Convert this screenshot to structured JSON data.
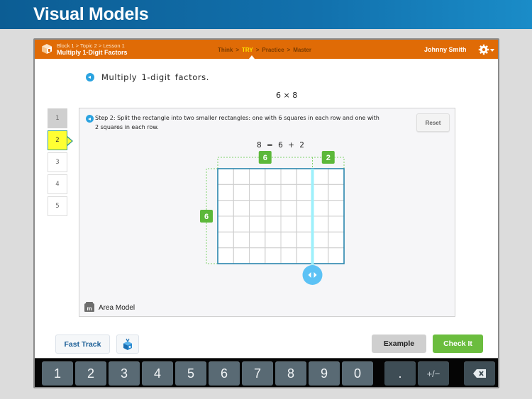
{
  "banner": {
    "title": "Visual Models"
  },
  "header": {
    "breadcrumb": "Block 1 > Topic 2 > Lesson 1",
    "lesson_title": "Multiply 1-Digit Factors",
    "phases": [
      "Think",
      "TRY",
      "Practice",
      "Master"
    ],
    "active_phase": "TRY",
    "separator": ">",
    "user_name": "Johnny Smith",
    "accent_color": "#e06b06"
  },
  "prompt": {
    "text": "Multiply 1-digit factors.",
    "problem": "6 × 8"
  },
  "steps": {
    "items": [
      "1",
      "2",
      "3",
      "4",
      "5"
    ],
    "current": "2",
    "completed": [
      "1"
    ]
  },
  "work": {
    "instruction": "Step 2: Split the rectangle into two smaller rectangles: one with 6 squares in each row and one with 2 squares in each row.",
    "reset_label": "Reset",
    "equation": "8 = 6 + 2",
    "grid": {
      "rows": 6,
      "columns": 8,
      "split_after_column": 6
    },
    "labels": {
      "top_left": "6",
      "top_right": "2",
      "left": "6"
    },
    "model_name": "Area Model",
    "model_icon": "m"
  },
  "actions": {
    "fast_track": "Fast Track",
    "example": "Example",
    "check_it": "Check It"
  },
  "keypad": {
    "digits": [
      "1",
      "2",
      "3",
      "4",
      "5",
      "6",
      "7",
      "8",
      "9",
      "0"
    ],
    "decimal": ".",
    "sign": "+/−",
    "backspace": "backspace-icon"
  }
}
